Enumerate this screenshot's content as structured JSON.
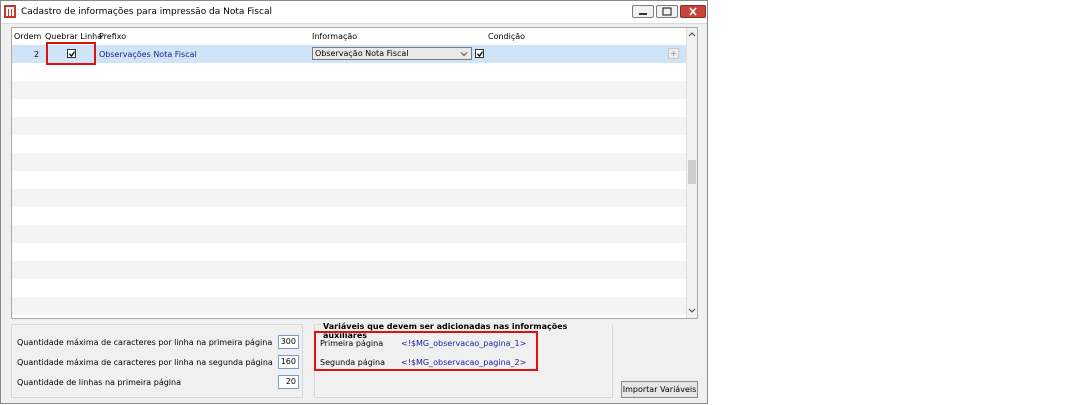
{
  "window": {
    "title": "Cadastro de informações para impressão da Nota Fiscal",
    "controls": [
      "minimize-icon",
      "maximize-icon",
      "close-icon"
    ]
  },
  "grid": {
    "columns": [
      "Ordem",
      "Quebrar Linha",
      "Prefixo",
      "Informação",
      "Condição"
    ],
    "rows": [
      {
        "ordem": "2",
        "quebrar_linha": true,
        "prefixo": "Observações Nota Fiscal",
        "informacao": "Observação Nota Fiscal",
        "condicao": true
      }
    ]
  },
  "quantities": [
    {
      "label": "Quantidade máxima de caracteres por linha na primeira página",
      "value": "300"
    },
    {
      "label": "Quantidade máxima de caracteres por linha na segunda página",
      "value": "160"
    },
    {
      "label": "Quantidade de linhas na primeira página",
      "value": "20"
    }
  ],
  "variables": {
    "title": "Variáveis que devem ser adicionadas nas informações auxiliares",
    "items": [
      {
        "label": "Primeira página",
        "value": "<!$MG_observacao_pagina_1>"
      },
      {
        "label": "Segunda página",
        "value": "<!$MG_observacao_pagina_2>"
      }
    ]
  },
  "buttons": {
    "import": "Importar Variáveis"
  },
  "colors": {
    "selected_row": "#cfe4f7",
    "highlight": "#e01010",
    "variable_text": "#1b1b9a"
  }
}
